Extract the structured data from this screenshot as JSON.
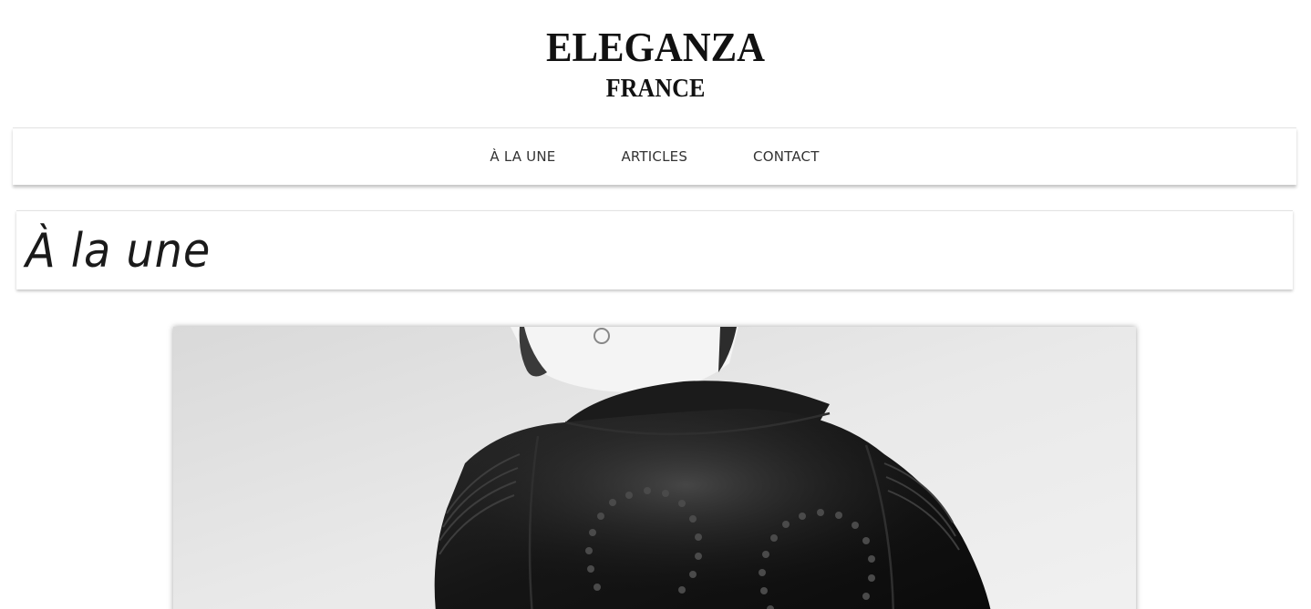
{
  "site": {
    "logo_line1": "ELEGANZA",
    "logo_line2": "FRANCE"
  },
  "nav": {
    "items": [
      {
        "label": "À LA UNE"
      },
      {
        "label": "ARTICLES"
      },
      {
        "label": "CONTACT"
      }
    ]
  },
  "section": {
    "title": "À la une"
  },
  "featured": {
    "image_subject": "black-leather-studded-jacket-back"
  },
  "colors": {
    "background": "#ffffff",
    "text": "#111111",
    "nav_text": "#333333",
    "divider": "#e2e2e2"
  }
}
